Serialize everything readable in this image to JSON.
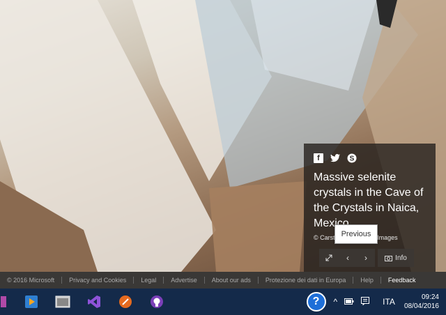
{
  "image": {
    "subject": "selenite crystals background"
  },
  "panel": {
    "share_icons": [
      "facebook-icon",
      "twitter-icon",
      "skype-icon"
    ],
    "title": "Massive selenite crystals in the Cave of the Crystals in Naica, Mexico",
    "credit": "© Carsten Peter/Getty Images",
    "info_label": "Info"
  },
  "tooltip": {
    "text": "Previous"
  },
  "footer": {
    "links": [
      "© 2016 Microsoft",
      "Privacy and Cookies",
      "Legal",
      "Advertise",
      "About our ads",
      "Protezione dei dati in Europa",
      "Help"
    ],
    "feedback": "Feedback"
  },
  "taskbar": {
    "apps": [
      "media-player-icon",
      "file-explorer-icon",
      "visual-studio-icon",
      "pen-app-icon",
      "github-icon"
    ],
    "language": "ITA",
    "time": "09:24",
    "date": "08/04/2016"
  },
  "colors": {
    "taskbar": "#142a4a",
    "footer": "#3a3836",
    "panel": "#28231f",
    "help_blue": "#1e6fd8"
  }
}
